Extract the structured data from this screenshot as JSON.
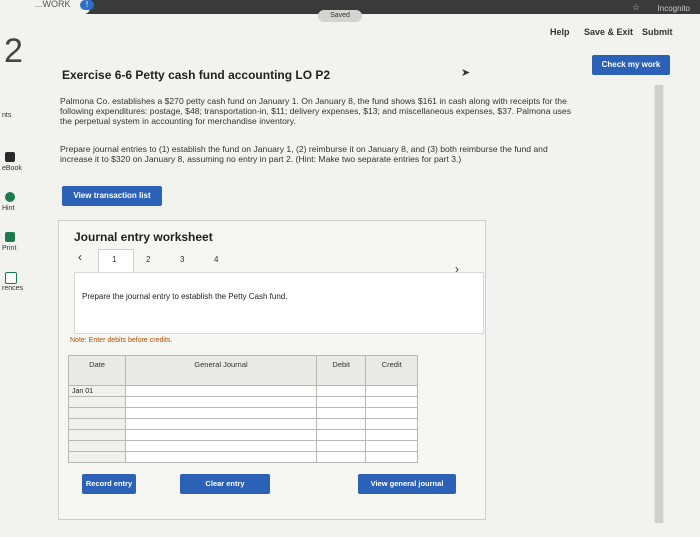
{
  "browser": {
    "tab_fragment": "...WORK",
    "tab_badge": "!",
    "incognito": "Incognito"
  },
  "status": {
    "saved": "Saved"
  },
  "topnav": {
    "help": "Help",
    "save_exit": "Save & Exit",
    "submit": "Submit"
  },
  "question_number": "2",
  "rail": {
    "pts": "nts",
    "ebook": "eBook",
    "hint": "Hint",
    "print": "Print",
    "references": "rences"
  },
  "check_button": "Check my work",
  "exercise_title": "Exercise 6-6 Petty cash fund accounting LO P2",
  "paragraph1": [
    "Palmona Co. establishes a $270 petty cash fund on January 1. On January 8, the fund shows $161 in cash along with receipts for the",
    "following expenditures: postage, $48; transportation-in, $11; delivery expenses, $13; and miscellaneous expenses, $37. Palmona uses",
    "the perpetual system in accounting for merchandise inventory."
  ],
  "paragraph2": [
    "Prepare journal entries to (1) establish the fund on January 1, (2) reimburse it on January 8, and (3) both reimburse the fund and",
    "increase it to $320 on January 8, assuming no entry in part 2. (Hint: Make two separate entries for part 3.)"
  ],
  "view_transaction_button": "View transaction list",
  "worksheet": {
    "title": "Journal entry worksheet",
    "pages": [
      "1",
      "2",
      "3",
      "4"
    ],
    "current_page": "1",
    "instruction": "Prepare the journal entry to establish the Petty Cash fund.",
    "note": "Note: Enter debits before credits.",
    "columns": [
      "Date",
      "General Journal",
      "Debit",
      "Credit"
    ],
    "rows": [
      {
        "date": "Jan 01",
        "account": "",
        "debit": "",
        "credit": ""
      },
      {
        "date": "",
        "account": "",
        "debit": "",
        "credit": ""
      },
      {
        "date": "",
        "account": "",
        "debit": "",
        "credit": ""
      },
      {
        "date": "",
        "account": "",
        "debit": "",
        "credit": ""
      },
      {
        "date": "",
        "account": "",
        "debit": "",
        "credit": ""
      },
      {
        "date": "",
        "account": "",
        "debit": "",
        "credit": ""
      },
      {
        "date": "",
        "account": "",
        "debit": "",
        "credit": ""
      }
    ],
    "record_button": "Record entry",
    "clear_button": "Clear entry",
    "view_journal_button": "View general journal"
  },
  "colors": {
    "accent": "#2b62b8",
    "note": "#b35000"
  }
}
